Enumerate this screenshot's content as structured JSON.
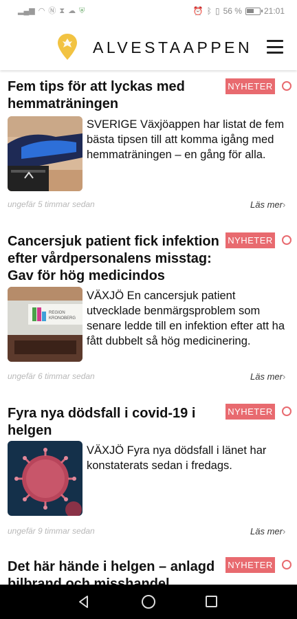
{
  "status_bar": {
    "left_icons": [
      "signal-icon",
      "wifi-icon",
      "nfc-icon",
      "hourglass-icon",
      "cloud-icon",
      "shield-icon"
    ],
    "right": {
      "icons": [
        "alarm-icon",
        "bluetooth-icon",
        "vibrate-icon"
      ],
      "battery": "56 %",
      "time": "21:01"
    }
  },
  "header": {
    "brand": "ALVESTAAPPEN",
    "logo_color": "#f2c342",
    "menu_icon": "hamburger-icon"
  },
  "colors": {
    "tag": "#e86a6f",
    "time": "#b8b8b8"
  },
  "articles": [
    {
      "headline": "Fem tips för att lyckas med hemmaträningen",
      "tag": "NYHETER",
      "excerpt": "SVERIGE Växjöappen har listat de fem bästa tipsen till att komma igång med hemmaträningen – en gång för alla.",
      "time": "ungefär 5 timmar sedan",
      "read_more": "Läs mer",
      "image": "workout-shoe-photo"
    },
    {
      "headline": "Cancersjuk patient fick infektion efter vårdpersonalens misstag: Gav för hög medicindos",
      "tag": "NYHETER",
      "excerpt": "VÄXJÖ En cancersjuk patient utvecklade benmärgsproblem som senare ledde till en infektion efter att ha fått dubbelt så hög medicinering.",
      "time": "ungefär 6 timmar sedan",
      "read_more": "Läs mer",
      "image": "region-kronoberg-sign-photo",
      "image_text": "REGION KRONOBERG"
    },
    {
      "headline": "Fyra nya dödsfall i covid-19 i helgen",
      "tag": "NYHETER",
      "excerpt": "VÄXJÖ Fyra nya dödsfall i länet har konstaterats sedan i fredags.",
      "time": "ungefär 9 timmar sedan",
      "read_more": "Läs mer",
      "image": "coronavirus-photo"
    },
    {
      "headline": "Det här hände i helgen – anlagd bilbrand och misshandel",
      "tag": "NYHETER"
    }
  ],
  "nav_bar": {
    "icons": [
      "back-icon",
      "home-icon",
      "recents-icon"
    ]
  }
}
